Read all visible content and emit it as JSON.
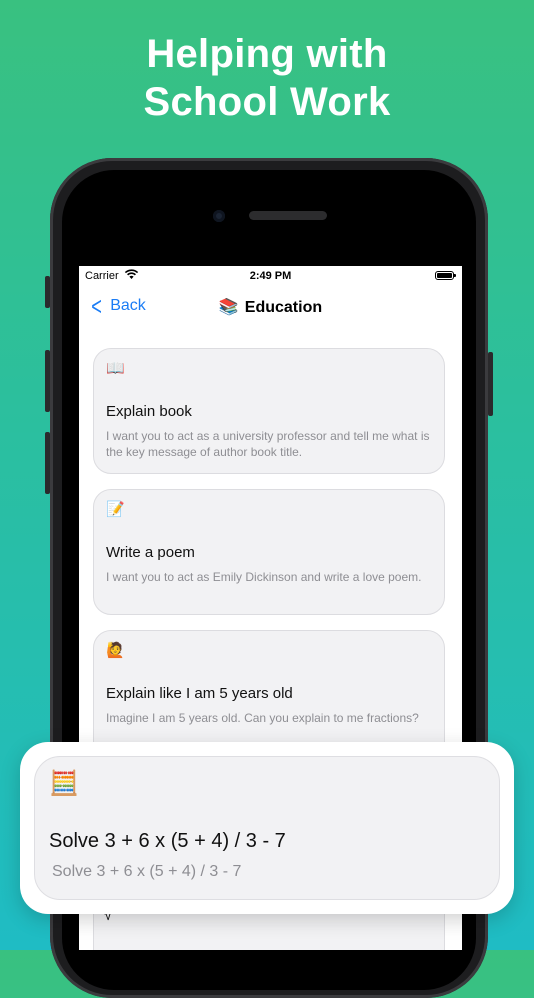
{
  "headline": {
    "line1": "Helping with",
    "line2": "School Work"
  },
  "statusbar": {
    "carrier": "Carrier",
    "time": "2:49 PM"
  },
  "navbar": {
    "back_label": "Back",
    "title_emoji": "📚",
    "title": "Education"
  },
  "cards": [
    {
      "emoji": "📖",
      "title": "Explain book",
      "desc": "I want you to act as a university professor and tell me what is the key message of author book title."
    },
    {
      "emoji": "📝",
      "title": "Write a poem",
      "desc": "I want you to act as Emily Dickinson and write a love poem."
    },
    {
      "emoji": "🙋",
      "title": "Explain like I am 5 years old",
      "desc": "Imagine I am 5 years old. Can you explain to me fractions?"
    }
  ],
  "overlay_card": {
    "emoji": "🧮",
    "title": "Solve 3 + 6 x (5 + 4) / 3 - 7",
    "desc": "Solve 3 + 6 x (5 + 4) / 3 - 7"
  },
  "next_card_icon": "√"
}
